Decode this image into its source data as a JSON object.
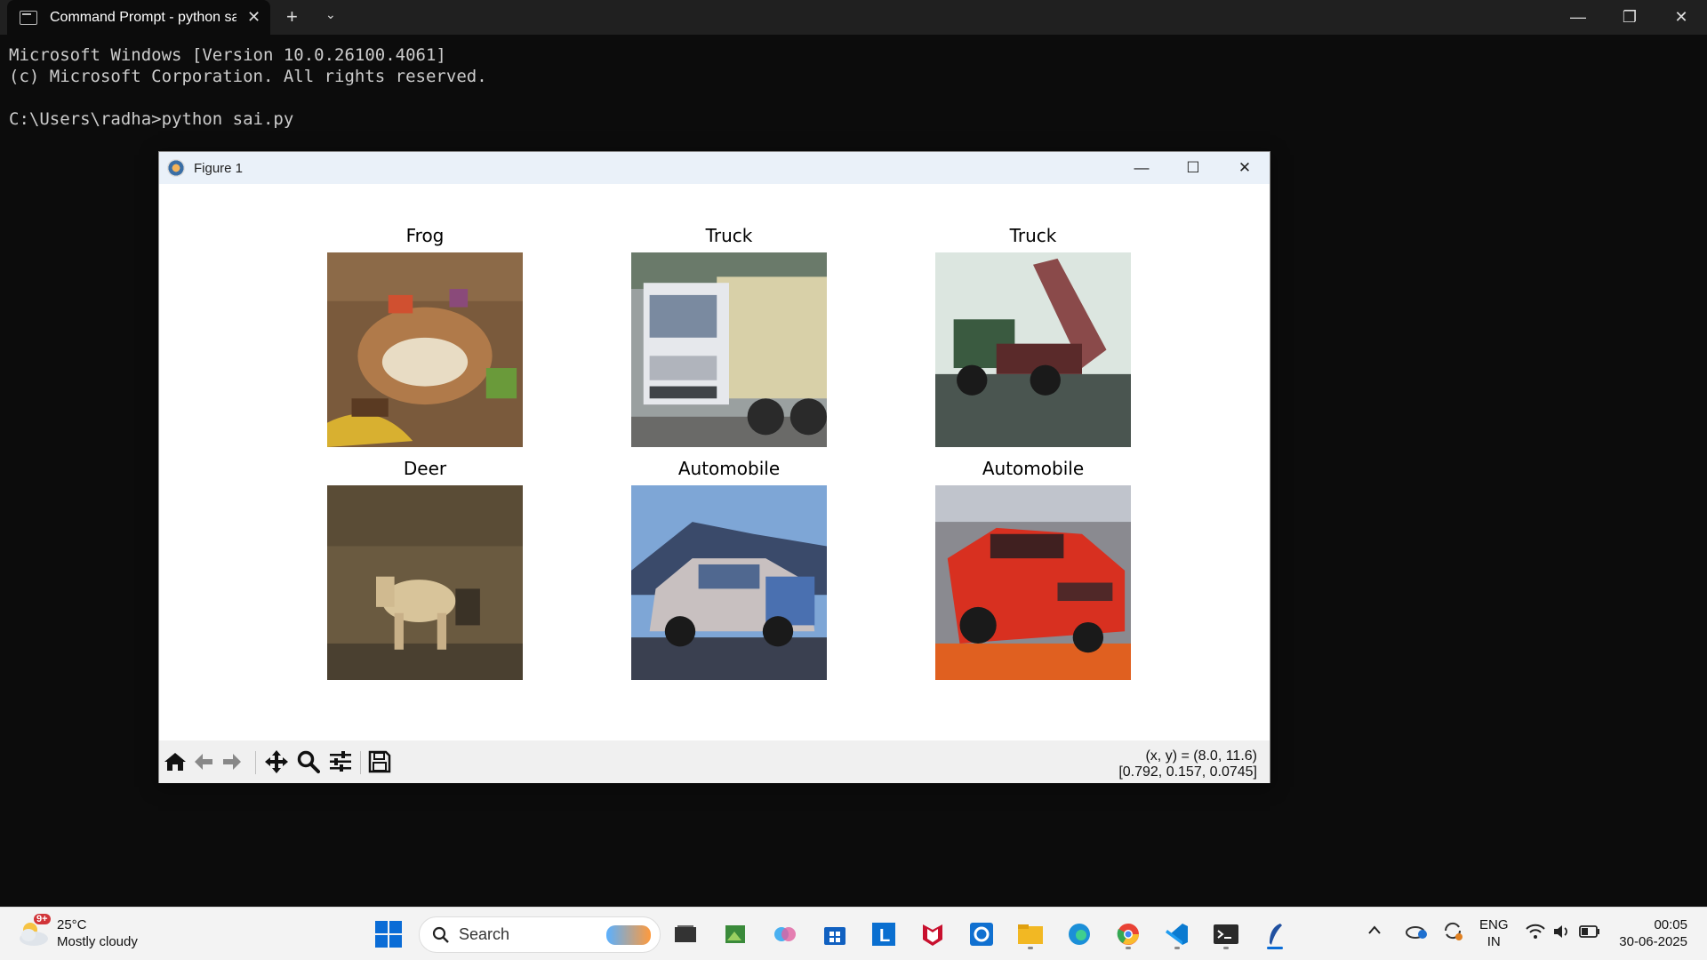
{
  "terminal": {
    "tab_title": "Command Prompt - python sai.py",
    "lines": [
      "Microsoft Windows [Version 10.0.26100.4061]",
      "(c) Microsoft Corporation. All rights reserved.",
      "",
      "C:\\Users\\radha>python sai.py"
    ]
  },
  "figure": {
    "title": "Figure 1",
    "panels": [
      {
        "label": "Frog"
      },
      {
        "label": "Truck"
      },
      {
        "label": "Truck"
      },
      {
        "label": "Deer"
      },
      {
        "label": "Automobile"
      },
      {
        "label": "Automobile"
      }
    ],
    "toolbar": {
      "buttons": [
        "home-icon",
        "back-icon",
        "forward-icon",
        "pan-icon",
        "zoom-icon",
        "configure-icon",
        "save-icon"
      ],
      "coord_line1": "(x, y) = (8.0, 11.6)",
      "coord_line2": "[0.792, 0.157, 0.0745]"
    }
  },
  "taskbar": {
    "weather_badge": "9+",
    "temperature": "25°C",
    "weather_desc": "Mostly cloudy",
    "search_label": "Search",
    "lang_line1": "ENG",
    "lang_line2": "IN",
    "time": "00:05",
    "date": "30-06-2025"
  }
}
